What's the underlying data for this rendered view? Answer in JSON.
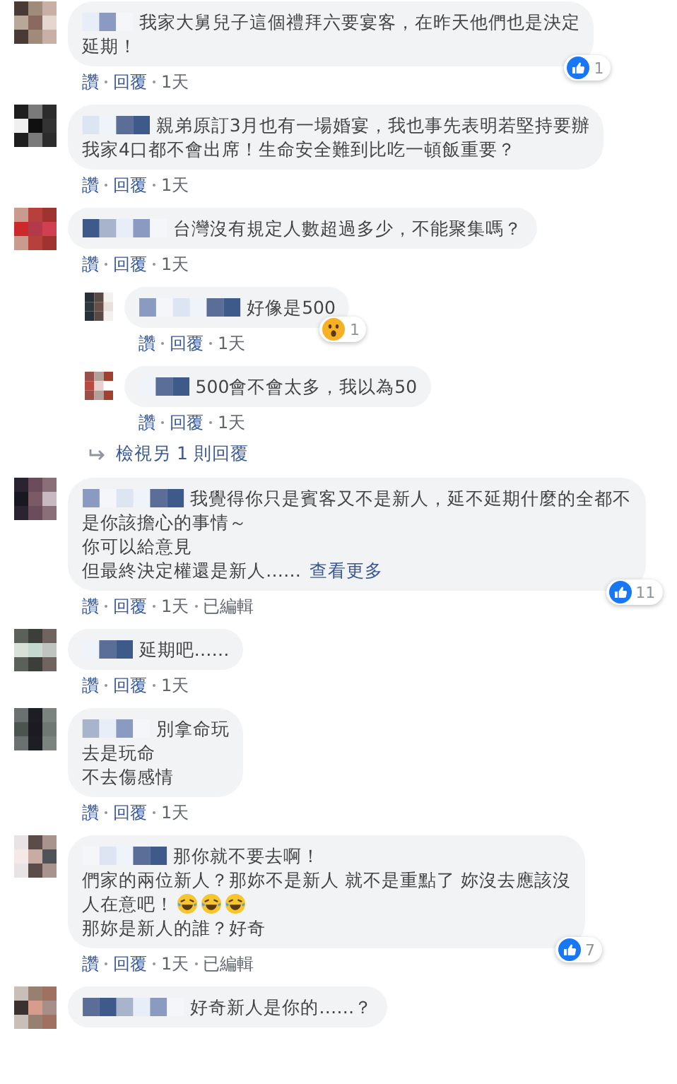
{
  "comments": [
    {
      "lines": [
        "我家大舅兒子這個禮拜六要宴客，在昨天他們也是決定",
        "延期！"
      ],
      "actions": [
        "讚",
        "回覆",
        "1天"
      ],
      "reaction": {
        "kind": "like",
        "count": "1"
      }
    },
    {
      "lines": [
        "親弟原訂3月也有一場婚宴，我也事先表明若堅持要辦",
        "我家4口都不會出席！生命安全難到比吃一頓飯重要？"
      ],
      "actions": [
        "讚",
        "回覆",
        "1天"
      ]
    },
    {
      "lines": [
        "台灣沒有規定人數超過多少，不能聚集嗎？"
      ],
      "actions": [
        "讚",
        "回覆",
        "1天"
      ],
      "replies": [
        {
          "lines": [
            "好像是500"
          ],
          "actions": [
            "讚",
            "回覆",
            "1天"
          ],
          "reaction": {
            "kind": "wow",
            "count": "1"
          }
        },
        {
          "lines": [
            "500會不會太多，我以為50"
          ],
          "actions": [
            "讚",
            "回覆",
            "1天"
          ]
        }
      ],
      "more_replies": "檢視另 1 則回覆"
    },
    {
      "lines": [
        "我覺得你只是賓客又不是新人，延不延期什麼的全都不",
        "是你該擔心的事情～",
        "你可以給意見",
        "但最終決定權還是新人……"
      ],
      "see_more": "查看更多",
      "actions": [
        "讚",
        "回覆",
        "1天"
      ],
      "edited": "已編輯",
      "reaction": {
        "kind": "like",
        "count": "11"
      }
    },
    {
      "lines": [
        "延期吧……"
      ],
      "actions": [
        "讚",
        "回覆",
        "1天"
      ]
    },
    {
      "lines": [
        "別拿命玩",
        "去是玩命",
        "不去傷感情"
      ],
      "actions": [
        "讚",
        "回覆",
        "1天"
      ]
    },
    {
      "lines": [
        "那你就不要去啊！",
        "們家的兩位新人？那妳不是新人 就不是重點了 妳沒去應該沒",
        {
          "text": "人在意吧！",
          "emojis": [
            {
              "kind": "laugh"
            },
            {
              "kind": "laugh"
            },
            {
              "kind": "laugh"
            }
          ]
        },
        "那妳是新人的誰？好奇"
      ],
      "actions": [
        "讚",
        "回覆",
        "1天"
      ],
      "edited": "已編輯",
      "reaction": {
        "kind": "like",
        "count": "7"
      }
    },
    {
      "lines": [
        "好奇新人是你的……？"
      ]
    }
  ]
}
